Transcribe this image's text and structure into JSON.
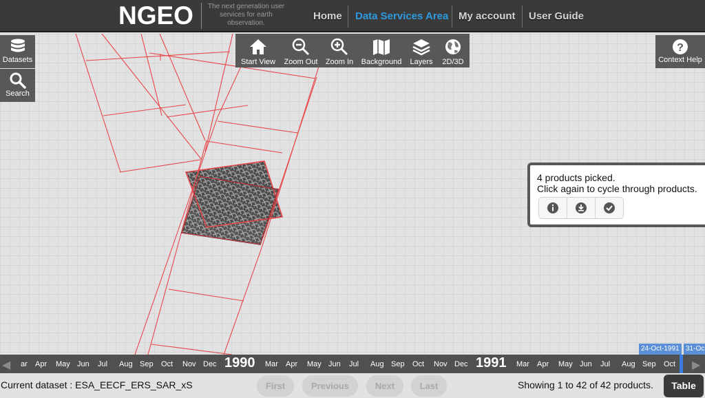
{
  "header": {
    "logo": "NGEO",
    "tagline": "The next generation user services for earth observation.",
    "nav": [
      {
        "label": "Home",
        "active": false
      },
      {
        "label": "Data Services Area",
        "active": true
      },
      {
        "label": "My account",
        "active": false
      },
      {
        "label": "User Guide",
        "active": false
      }
    ]
  },
  "left_tools": {
    "datasets": "Datasets",
    "search": "Search"
  },
  "map_toolbar": {
    "start_view": "Start View",
    "zoom_out": "Zoom Out",
    "zoom_in": "Zoom In",
    "background": "Background",
    "layers": "Layers",
    "view_mode": "2D/3D"
  },
  "context_help": "Context Help",
  "popup": {
    "line1": "4 products picked.",
    "line2": "Click again to cycle through products.",
    "buttons": [
      "info-icon",
      "download-icon",
      "check-icon"
    ]
  },
  "timeline": {
    "months_1989_tail": [
      "ar",
      "Apr",
      "May",
      "Jun",
      "Jul",
      "Aug",
      "Sep",
      "Oct",
      "Nov",
      "Dec"
    ],
    "year1": "1990",
    "months_1990": [
      "Mar",
      "Apr",
      "May",
      "Jun",
      "Jul",
      "Aug",
      "Sep",
      "Oct",
      "Nov",
      "Dec"
    ],
    "year2": "1991",
    "months_1991": [
      "Mar",
      "Apr",
      "May",
      "Jun",
      "Jul",
      "Aug",
      "Sep",
      "Oct"
    ],
    "range_start": "24-Oct-1991",
    "range_end": "31-Oc"
  },
  "status": {
    "dataset": "Current dataset : ESA_EECF_ERS_SAR_xS",
    "first": "First",
    "previous": "Previous",
    "next": "Next",
    "last": "Last",
    "count": "Showing 1 to 42 of 42 products.",
    "table": "Table"
  },
  "colors": {
    "accent": "#2e9adf",
    "footprint": "#e8464a",
    "toolbar": "#585858"
  }
}
